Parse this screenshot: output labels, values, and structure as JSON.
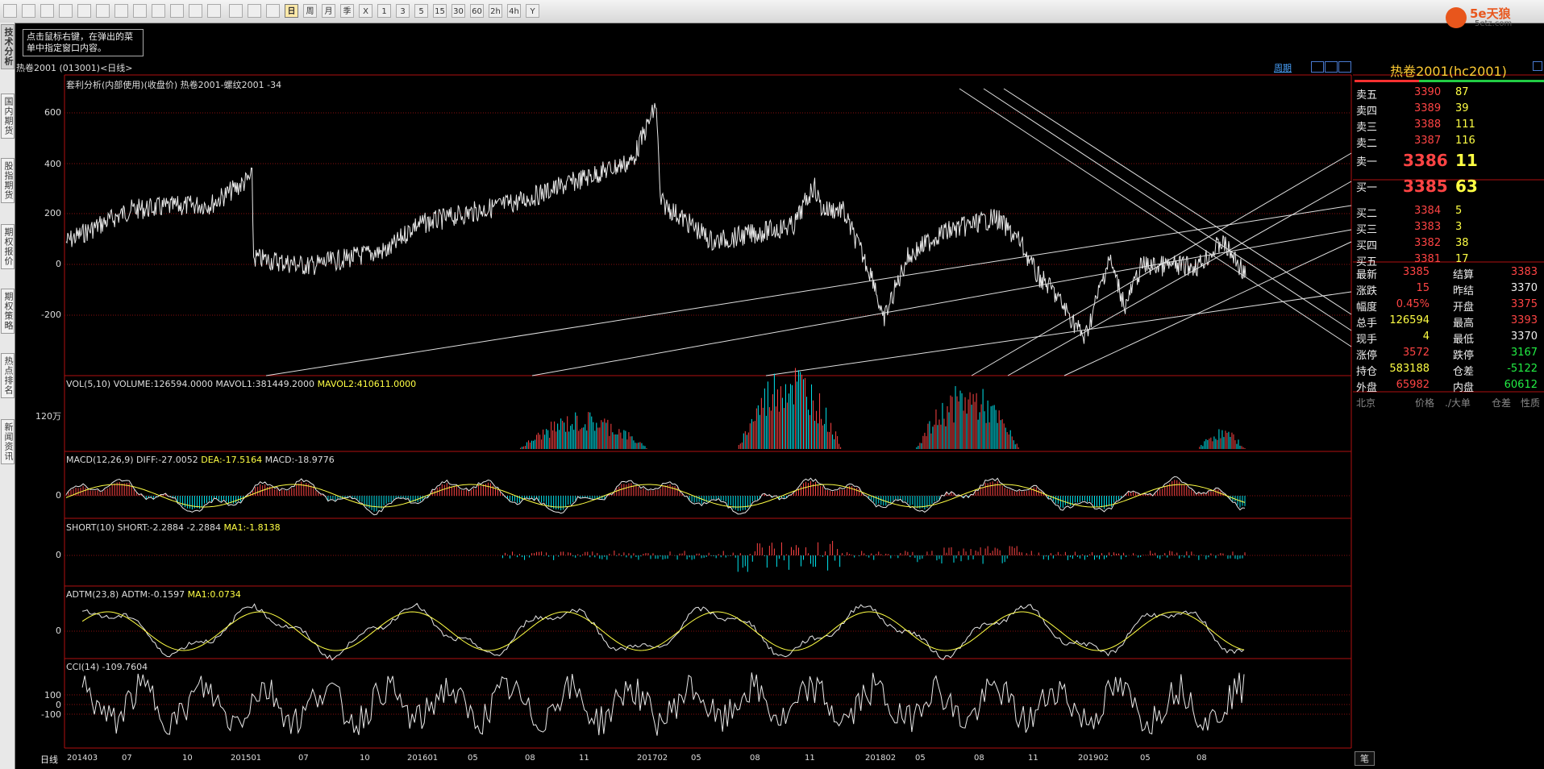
{
  "toolbar": {
    "period_buttons": [
      "日",
      "周",
      "月",
      "季",
      "X",
      "1",
      "3",
      "5",
      "15",
      "30",
      "60",
      "2h",
      "4h",
      "Y"
    ]
  },
  "side_tabs": [
    "技术分析",
    "国内期货",
    "股指期货",
    "期权报价",
    "期权策略",
    "热点排名",
    "新闻资讯"
  ],
  "tip": {
    "text": "点击鼠标右键，在弹出的菜单中指定窗口内容。"
  },
  "logo": {
    "brand": "5e天狼",
    "url_text": "5etz.com"
  },
  "header": {
    "title": "热卷2001 (013001)<日线>",
    "period": "周期"
  },
  "panels": {
    "main": {
      "label": "套利分析(内部使用)(收盘价) 热卷2001-螺纹2001  -34",
      "ticks": [
        "600",
        "400",
        "200",
        "0",
        "-200"
      ]
    },
    "vol": {
      "label_white": "VOL(5,10) VOLUME:126594.0000 MAVOL1:381449.2000",
      "label_yellow": "MAVOL2:410611.0000",
      "tick": "120万"
    },
    "macd": {
      "label_white": "MACD(12,26,9) DIFF:-27.0052",
      "label_yellow": "DEA:-17.5164",
      "label_white2": "MACD:-18.9776",
      "tick": "0"
    },
    "short": {
      "label_white": "SHORT(10) SHORT:-2.2884 -2.2884",
      "label_yellow": "MA1:-1.8138",
      "tick": "0"
    },
    "adtm": {
      "label_white": "ADTM(23,8) ADTM:-0.1597",
      "label_yellow": "MA1:0.0734",
      "tick": "0"
    },
    "cci": {
      "label_white": "CCI(14) -109.7604",
      "ticks": [
        "100",
        "0",
        "-100"
      ]
    }
  },
  "xaxis": {
    "corner": "日线",
    "labels": [
      "201403",
      "07",
      "10",
      "201501",
      "07",
      "10",
      "201601",
      "05",
      "08",
      "11",
      "201702",
      "05",
      "08",
      "11",
      "201802",
      "05",
      "08",
      "11",
      "201902",
      "05",
      "08"
    ]
  },
  "quote": {
    "title": "热卷2001(hc2001)",
    "asks": [
      {
        "label": "卖五",
        "price": "3390",
        "vol": "87"
      },
      {
        "label": "卖四",
        "price": "3389",
        "vol": "39"
      },
      {
        "label": "卖三",
        "price": "3388",
        "vol": "111"
      },
      {
        "label": "卖二",
        "price": "3387",
        "vol": "116"
      },
      {
        "label": "卖一",
        "price": "3386",
        "vol": "11"
      }
    ],
    "bids": [
      {
        "label": "买一",
        "price": "3385",
        "vol": "63"
      },
      {
        "label": "买二",
        "price": "3384",
        "vol": "5"
      },
      {
        "label": "买三",
        "price": "3383",
        "vol": "3"
      },
      {
        "label": "买四",
        "price": "3382",
        "vol": "38"
      },
      {
        "label": "买五",
        "price": "3381",
        "vol": "17"
      }
    ],
    "stats": [
      {
        "l1": "最新",
        "v1": "3385",
        "c1": "red",
        "l2": "结算",
        "v2": "3383",
        "c2": "red"
      },
      {
        "l1": "涨跌",
        "v1": "15",
        "c1": "red",
        "l2": "昨结",
        "v2": "3370",
        "c2": "wht"
      },
      {
        "l1": "幅度",
        "v1": "0.45%",
        "c1": "red",
        "l2": "开盘",
        "v2": "3375",
        "c2": "red"
      },
      {
        "l1": "总手",
        "v1": "126594",
        "c1": "yel",
        "l2": "最高",
        "v2": "3393",
        "c2": "red"
      },
      {
        "l1": "现手",
        "v1": "4",
        "c1": "yel",
        "l2": "最低",
        "v2": "3370",
        "c2": "wht"
      },
      {
        "l1": "涨停",
        "v1": "3572",
        "c1": "red",
        "l2": "跌停",
        "v2": "3167",
        "c2": "grn"
      },
      {
        "l1": "持仓",
        "v1": "583188",
        "c1": "yel",
        "l2": "仓差",
        "v2": "-5122",
        "c2": "grn"
      },
      {
        "l1": "外盘",
        "v1": "65982",
        "c1": "red",
        "l2": "内盘",
        "v2": "60612",
        "c2": "grn"
      }
    ],
    "ticks_header": [
      "北京",
      "价格",
      "./大单",
      "仓差",
      "性质"
    ],
    "footer_tab": "笔"
  },
  "colors": {
    "grid_red": "#8a1010",
    "ask_red": "#ff4444",
    "bid_yellow": "#ffff44",
    "down_green": "#22ee44",
    "cyan": "#00e5ee"
  }
}
